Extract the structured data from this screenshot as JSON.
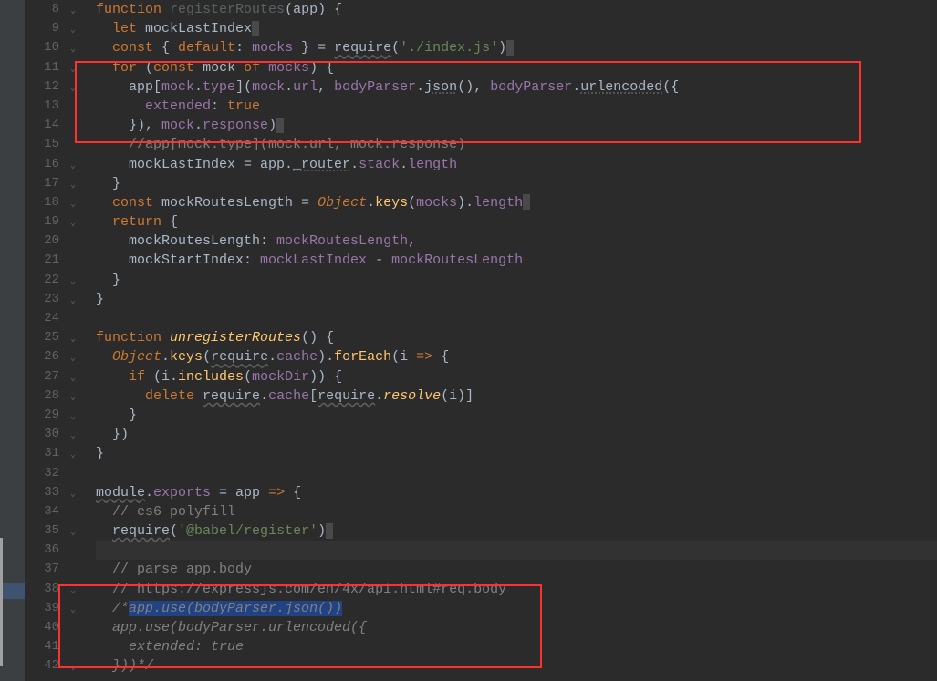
{
  "lines": [
    {
      "num": 8,
      "html": "<span class='c-kw'>function</span> <span style='color:#5c6164'>registerRoutes</span>(<span>app</span>) {"
    },
    {
      "num": 9,
      "html": "  <span class='c-kw'>let</span> mockLastIndex<span class='caret'></span>"
    },
    {
      "num": 10,
      "html": "  <span class='c-kw'>const</span> { <span class='c-kw'>default</span>: <span class='c-prop'>mocks</span> } = <span class='wavy'>require</span>(<span class='c-str'>'./index.js'</span>)<span class='caret'></span>"
    },
    {
      "num": 11,
      "html": "  <span class='c-kw'>for</span> (<span class='c-kw'>const</span> mock <span class='c-kw'>of</span> <span class='c-prop'>mocks</span>) {"
    },
    {
      "num": 12,
      "html": "    app[<span class='c-prop'>mock</span>.<span class='c-prop'>type</span>](<span class='c-prop'>mock</span>.<span class='c-prop'>url</span>, <span class='c-prop'>bodyParser</span>.<span class='c-param'>json</span>(), <span class='c-prop'>bodyParser</span>.<span class='c-param'>urlencoded</span>({"
    },
    {
      "num": 13,
      "html": "      <span class='c-prop'>extended</span>: <span class='c-true'>true</span>"
    },
    {
      "num": 14,
      "html": "    }), <span class='c-prop'>mock</span>.<span class='c-prop'>response</span>)<span class='caret'></span>"
    },
    {
      "num": 15,
      "html": "    <span class='c-cmt-code'>//app[mock.type](mock.url, mock.response)</span>"
    },
    {
      "num": 16,
      "html": "    mockLastIndex = app.<span class='c-param'>_router</span>.<span class='c-prop'>stack</span>.<span class='c-prop'>length</span>"
    },
    {
      "num": 17,
      "html": "  }"
    },
    {
      "num": 18,
      "html": "  <span class='c-kw'>const</span> mockRoutesLength = <span class='c-obj'>Object</span>.<span class='c-fn'>keys</span>(<span class='c-prop'>mocks</span>).<span class='c-prop'>length</span><span class='caret'></span>"
    },
    {
      "num": 19,
      "html": "  <span class='c-kw'>return</span> {"
    },
    {
      "num": 20,
      "html": "    mockRoutesLength: <span class='c-prop'>mockRoutesLength</span>,"
    },
    {
      "num": 21,
      "html": "    mockStartIndex: <span class='c-prop'>mockLastIndex</span> - <span class='c-prop'>mockRoutesLength</span>"
    },
    {
      "num": 22,
      "html": "  }"
    },
    {
      "num": 23,
      "html": "}"
    },
    {
      "num": 24,
      "html": ""
    },
    {
      "num": 25,
      "html": "<span class='c-kw'>function</span> <span class='c-func'>unregisterRoutes</span>() {"
    },
    {
      "num": 26,
      "html": "  <span class='c-obj'>Object</span>.<span class='c-fn'>keys</span>(<span class='wavy'>require</span>.<span class='c-prop'>cache</span>).<span class='c-fn'>forEach</span>(i <span class='c-kw'>=&gt;</span> {"
    },
    {
      "num": 27,
      "html": "    <span class='c-kw'>if</span> (i.<span class='c-fn'>includes</span>(<span class='c-prop'>mockDir</span>)) {"
    },
    {
      "num": 28,
      "html": "      <span class='c-kw'>delete</span> <span class='wavy'>require</span>.<span class='c-prop'>cache</span>[<span class='wavy'>require</span>.<span class='c-func'>resolve</span>(i)]"
    },
    {
      "num": 29,
      "html": "    }"
    },
    {
      "num": 30,
      "html": "  })"
    },
    {
      "num": 31,
      "html": "}"
    },
    {
      "num": 32,
      "html": ""
    },
    {
      "num": 33,
      "html": "<span class='wavy'>module</span>.<span class='c-prop'>exports</span> = app <span class='c-kw'>=&gt;</span> {"
    },
    {
      "num": 34,
      "html": "  <span class='c-cmt-code'>// es6 polyfill</span>"
    },
    {
      "num": 35,
      "html": "  <span class='wavy'>require</span>(<span class='c-str'>'@babel/register'</span>)<span class='caret'></span>"
    },
    {
      "num": 36,
      "html": "",
      "current": true
    },
    {
      "num": 37,
      "html": "  <span class='c-cmt-code'>// parse app.body</span>"
    },
    {
      "num": 38,
      "html": "  <span class='c-cmt-code'>// https://expressjs.com/en/4x/api.html#req.body</span>"
    },
    {
      "num": 39,
      "html": "  <span class='c-cmt'>/*</span><span class='c-cmt sel'>app.use(bodyParser.json())</span>"
    },
    {
      "num": 40,
      "html": "  <span class='c-cmt'>app.use(bodyParser.urlencoded({</span>"
    },
    {
      "num": 41,
      "html": "    <span class='c-cmt'>extended: true</span>"
    },
    {
      "num": 42,
      "html": "  <span class='c-cmt'>}))*/</span>"
    }
  ],
  "fold_marks": [
    8,
    9,
    10,
    11,
    12,
    16,
    17,
    18,
    19,
    22,
    23,
    25,
    26,
    27,
    28,
    29,
    30,
    31,
    33,
    35,
    38,
    39,
    42
  ],
  "annotations": {
    "box1": "lines 12-15",
    "box2": "lines 39-42"
  }
}
